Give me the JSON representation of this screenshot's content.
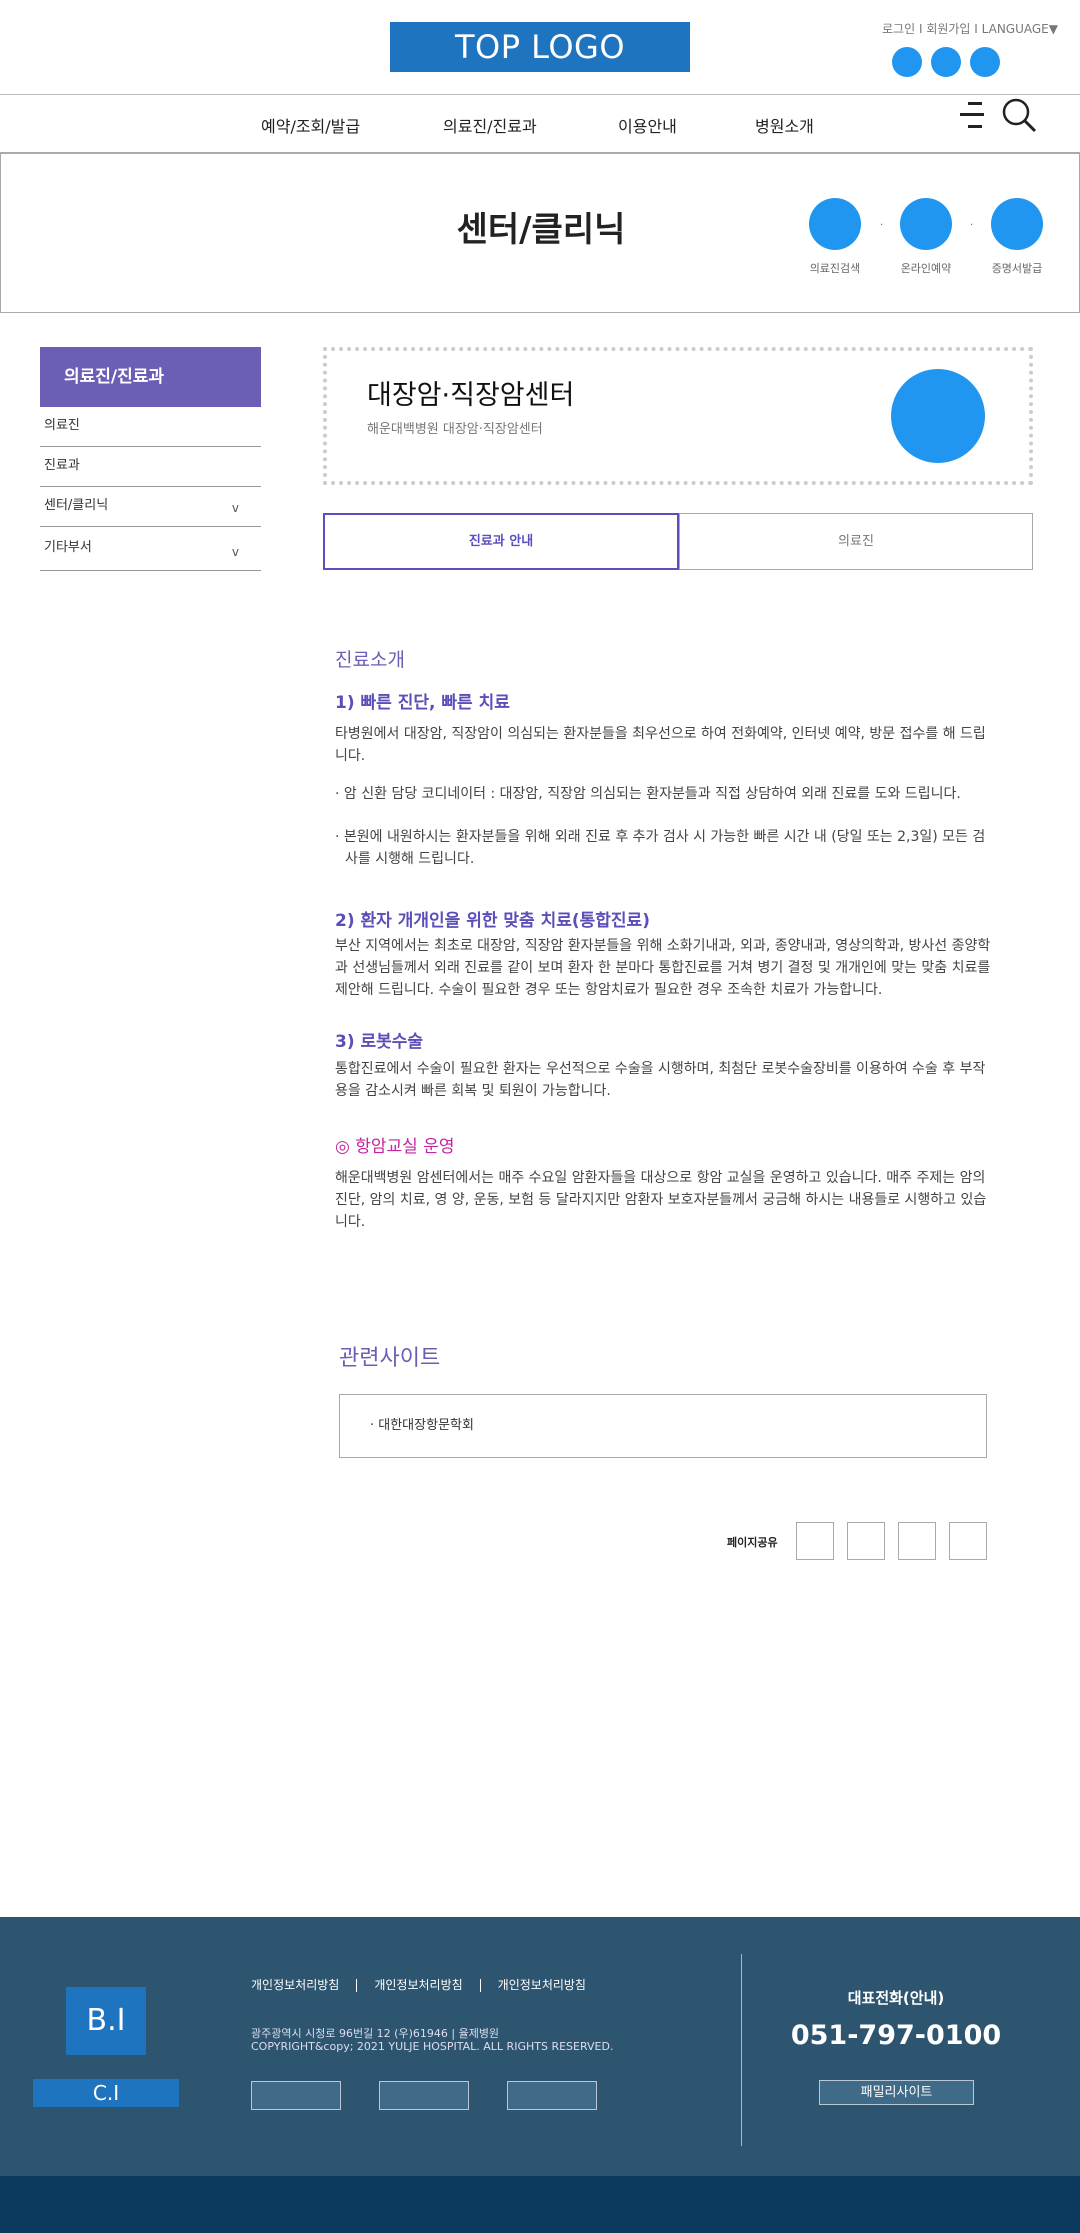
{
  "header": {
    "logo": "TOP LOGO",
    "util_links": {
      "login": "로그인",
      "join": "회원가입",
      "language": "LANGUAGE▼",
      "sep": " I "
    },
    "gnb": [
      "예약/조회/발급",
      "의료진/진료과",
      "이용안내",
      "병원소개"
    ]
  },
  "title_band": {
    "title": "센터/클리닉",
    "quick_links": [
      "의료진검색",
      "온라인예약",
      "증명서발급"
    ],
    "dot": "·"
  },
  "lnb": {
    "head": "의료진/진료과",
    "items": [
      {
        "label": "의료진",
        "arrow": ""
      },
      {
        "label": "진료과",
        "arrow": ""
      },
      {
        "label": "센터/클리닉",
        "arrow": "v"
      },
      {
        "label": "기타부서",
        "arrow": "v"
      }
    ]
  },
  "center": {
    "name": "대장암·직장암센터",
    "subtitle": "해운대백병원 대장암·직장암센터"
  },
  "tabs": [
    "진료과 안내",
    "의료진"
  ],
  "content": {
    "section_title": "진료소개",
    "s1_title": "1) 빠른 진단, 빠른 치료",
    "s1_text": "타병원에서 대장암, 직장암이 의심되는 환자분들을 최우선으로 하여 전화예약, 인터넷 예약, 방문 접수를 해 드립니다.",
    "s1_bullet1": "· 암 신환 담당 코디네이터 : 대장암, 직장암 의심되는 환자분들과 직접 상담하여 외래 진료를 도와 드립니다.",
    "s1_bullet2": "· 본원에 내원하시는 환자분들을 위해 외래 진료 후 추가 검사 시 가능한 빠른 시간 내 (당일 또는 2,3일) 모든 검사를 시행해 드립니다.",
    "s2_title": "2) 환자 개개인을 위한 맞춤 치료(통합진료)",
    "s2_text": "부산 지역에서는 최초로 대장암, 직장암 환자분들을 위해 소화기내과, 외과, 종양내과, 영상의학과, 방사선 종양학과 선생님들께서 외래 진료를 같이 보며 환자 한 분마다 통합진료를 거쳐 병기 결정 및 개개인에 맞는 맞춤 치료를 제안해 드립니다. 수술이 필요한 경우 또는 항암치료가 필요한 경우 조속한 치료가 가능합니다.",
    "s3_title": "3) 로봇수술",
    "s3_text": "통합진료에서 수술이 필요한 환자는 우선적으로 수술을 시행하며, 최첨단 로봇수술장비를 이용하여 수술 후 부작용을 감소시켜 빠른 회복 및 퇴원이 가능합니다.",
    "s4_title": "◎ 항암교실 운영",
    "s4_text": "해운대백병원 암센터에서는 매주 수요일 암환자들을 대상으로 항암 교실을 운영하고 있습니다. 매주 주제는 암의 진단, 암의 치료, 영 양, 운동, 보험 등 달라지지만 암환자 보호자분들께서 궁금해 하시는 내용들로 시행하고 있습니다."
  },
  "related": {
    "title": "관련사이트",
    "item": "·  대한대장항문학회"
  },
  "share": {
    "label": "페이지공유"
  },
  "footer": {
    "bi": "B.I",
    "ci": "C.I",
    "links": [
      "개인정보처리방침",
      "개인정보처리방침",
      "개인정보처리방침"
    ],
    "address": "광주광역시 시청로 96번길 12 (우)61946  |  율제병원",
    "copyright": "COPYRIGHT&copy; 2021 YULJE HOSPITAL. ALL RIGHTS RESERVED.",
    "tel_label": "대표전화(안내)",
    "tel": "051-797-0100",
    "family_site": "패밀리사이트"
  },
  "colors": {
    "brand_blue": "#1f74c0",
    "accent_circle": "#2196f0",
    "purple": "#6b5fb5",
    "pink": "#c3259e",
    "footer": "#2d5570",
    "footer_bottom": "#0c3a5e"
  }
}
